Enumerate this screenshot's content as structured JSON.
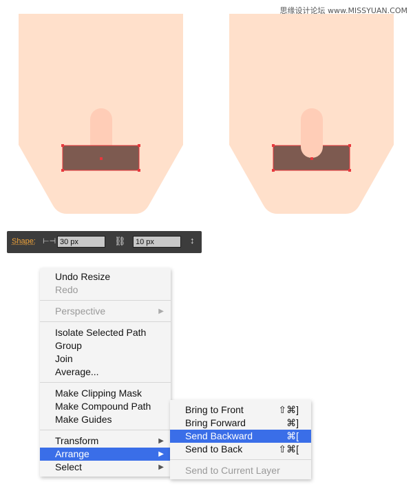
{
  "watermark": "思缘设计论坛 www.MISSYUAN.COM",
  "colors": {
    "skin": "#ffe0cb",
    "tongue": "#ffcdb7",
    "mouth": "#7d5a50",
    "selection": "#e8383d",
    "menu_highlight": "#3a6ee8",
    "toolbar_bg": "#3c3c3c",
    "shape_label": "#f0a33a"
  },
  "toolbar": {
    "shape_label": "Shape:",
    "width_icon": "width-icon",
    "width_value": "30 px",
    "link_icon": "link-icon",
    "height_value": "10 px",
    "height_icon": "height-icon"
  },
  "context_menu": {
    "undo": "Undo Resize",
    "redo": "Redo",
    "perspective": "Perspective",
    "isolate": "Isolate Selected Path",
    "group": "Group",
    "join": "Join",
    "average": "Average...",
    "clipping_mask": "Make Clipping Mask",
    "compound_path": "Make Compound Path",
    "guides": "Make Guides",
    "transform": "Transform",
    "arrange": "Arrange",
    "select": "Select"
  },
  "submenu": {
    "bring_front": "Bring to Front",
    "bring_front_sc": "⇧⌘]",
    "bring_forward": "Bring Forward",
    "bring_forward_sc": "⌘]",
    "send_backward": "Send Backward",
    "send_backward_sc": "⌘[",
    "send_back": "Send to Back",
    "send_back_sc": "⇧⌘[",
    "send_layer": "Send to Current Layer"
  }
}
